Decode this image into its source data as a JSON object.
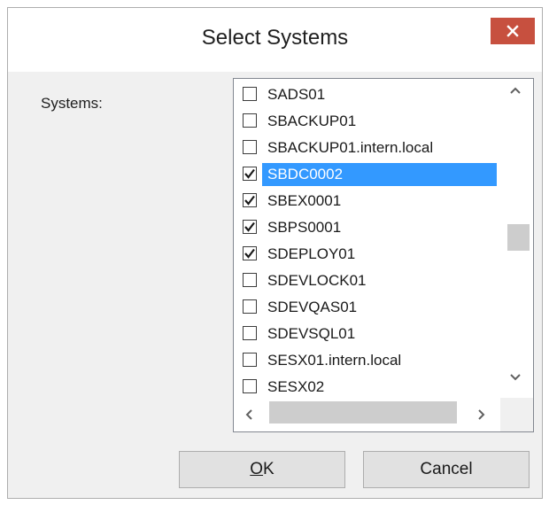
{
  "window": {
    "title": "Select Systems",
    "close_icon": "close-icon"
  },
  "form": {
    "systems_label": "Systems:"
  },
  "list": {
    "items": [
      {
        "label": "SADS01",
        "checked": false,
        "selected": false
      },
      {
        "label": "SBACKUP01",
        "checked": false,
        "selected": false
      },
      {
        "label": "SBACKUP01.intern.local",
        "checked": false,
        "selected": false
      },
      {
        "label": "SBDC0002",
        "checked": true,
        "selected": true
      },
      {
        "label": "SBEX0001",
        "checked": true,
        "selected": false
      },
      {
        "label": "SBPS0001",
        "checked": true,
        "selected": false
      },
      {
        "label": "SDEPLOY01",
        "checked": true,
        "selected": false
      },
      {
        "label": "SDEVLOCK01",
        "checked": false,
        "selected": false
      },
      {
        "label": "SDEVQAS01",
        "checked": false,
        "selected": false
      },
      {
        "label": "SDEVSQL01",
        "checked": false,
        "selected": false
      },
      {
        "label": "SESX01.intern.local",
        "checked": false,
        "selected": false
      },
      {
        "label": "SESX02",
        "checked": false,
        "selected": false
      }
    ]
  },
  "buttons": {
    "ok_accel": "O",
    "ok_rest": "K",
    "cancel_label": "Cancel"
  },
  "colors": {
    "selection": "#3399ff",
    "close_button": "#c7503f",
    "dialog_background": "#f0f0f0"
  }
}
